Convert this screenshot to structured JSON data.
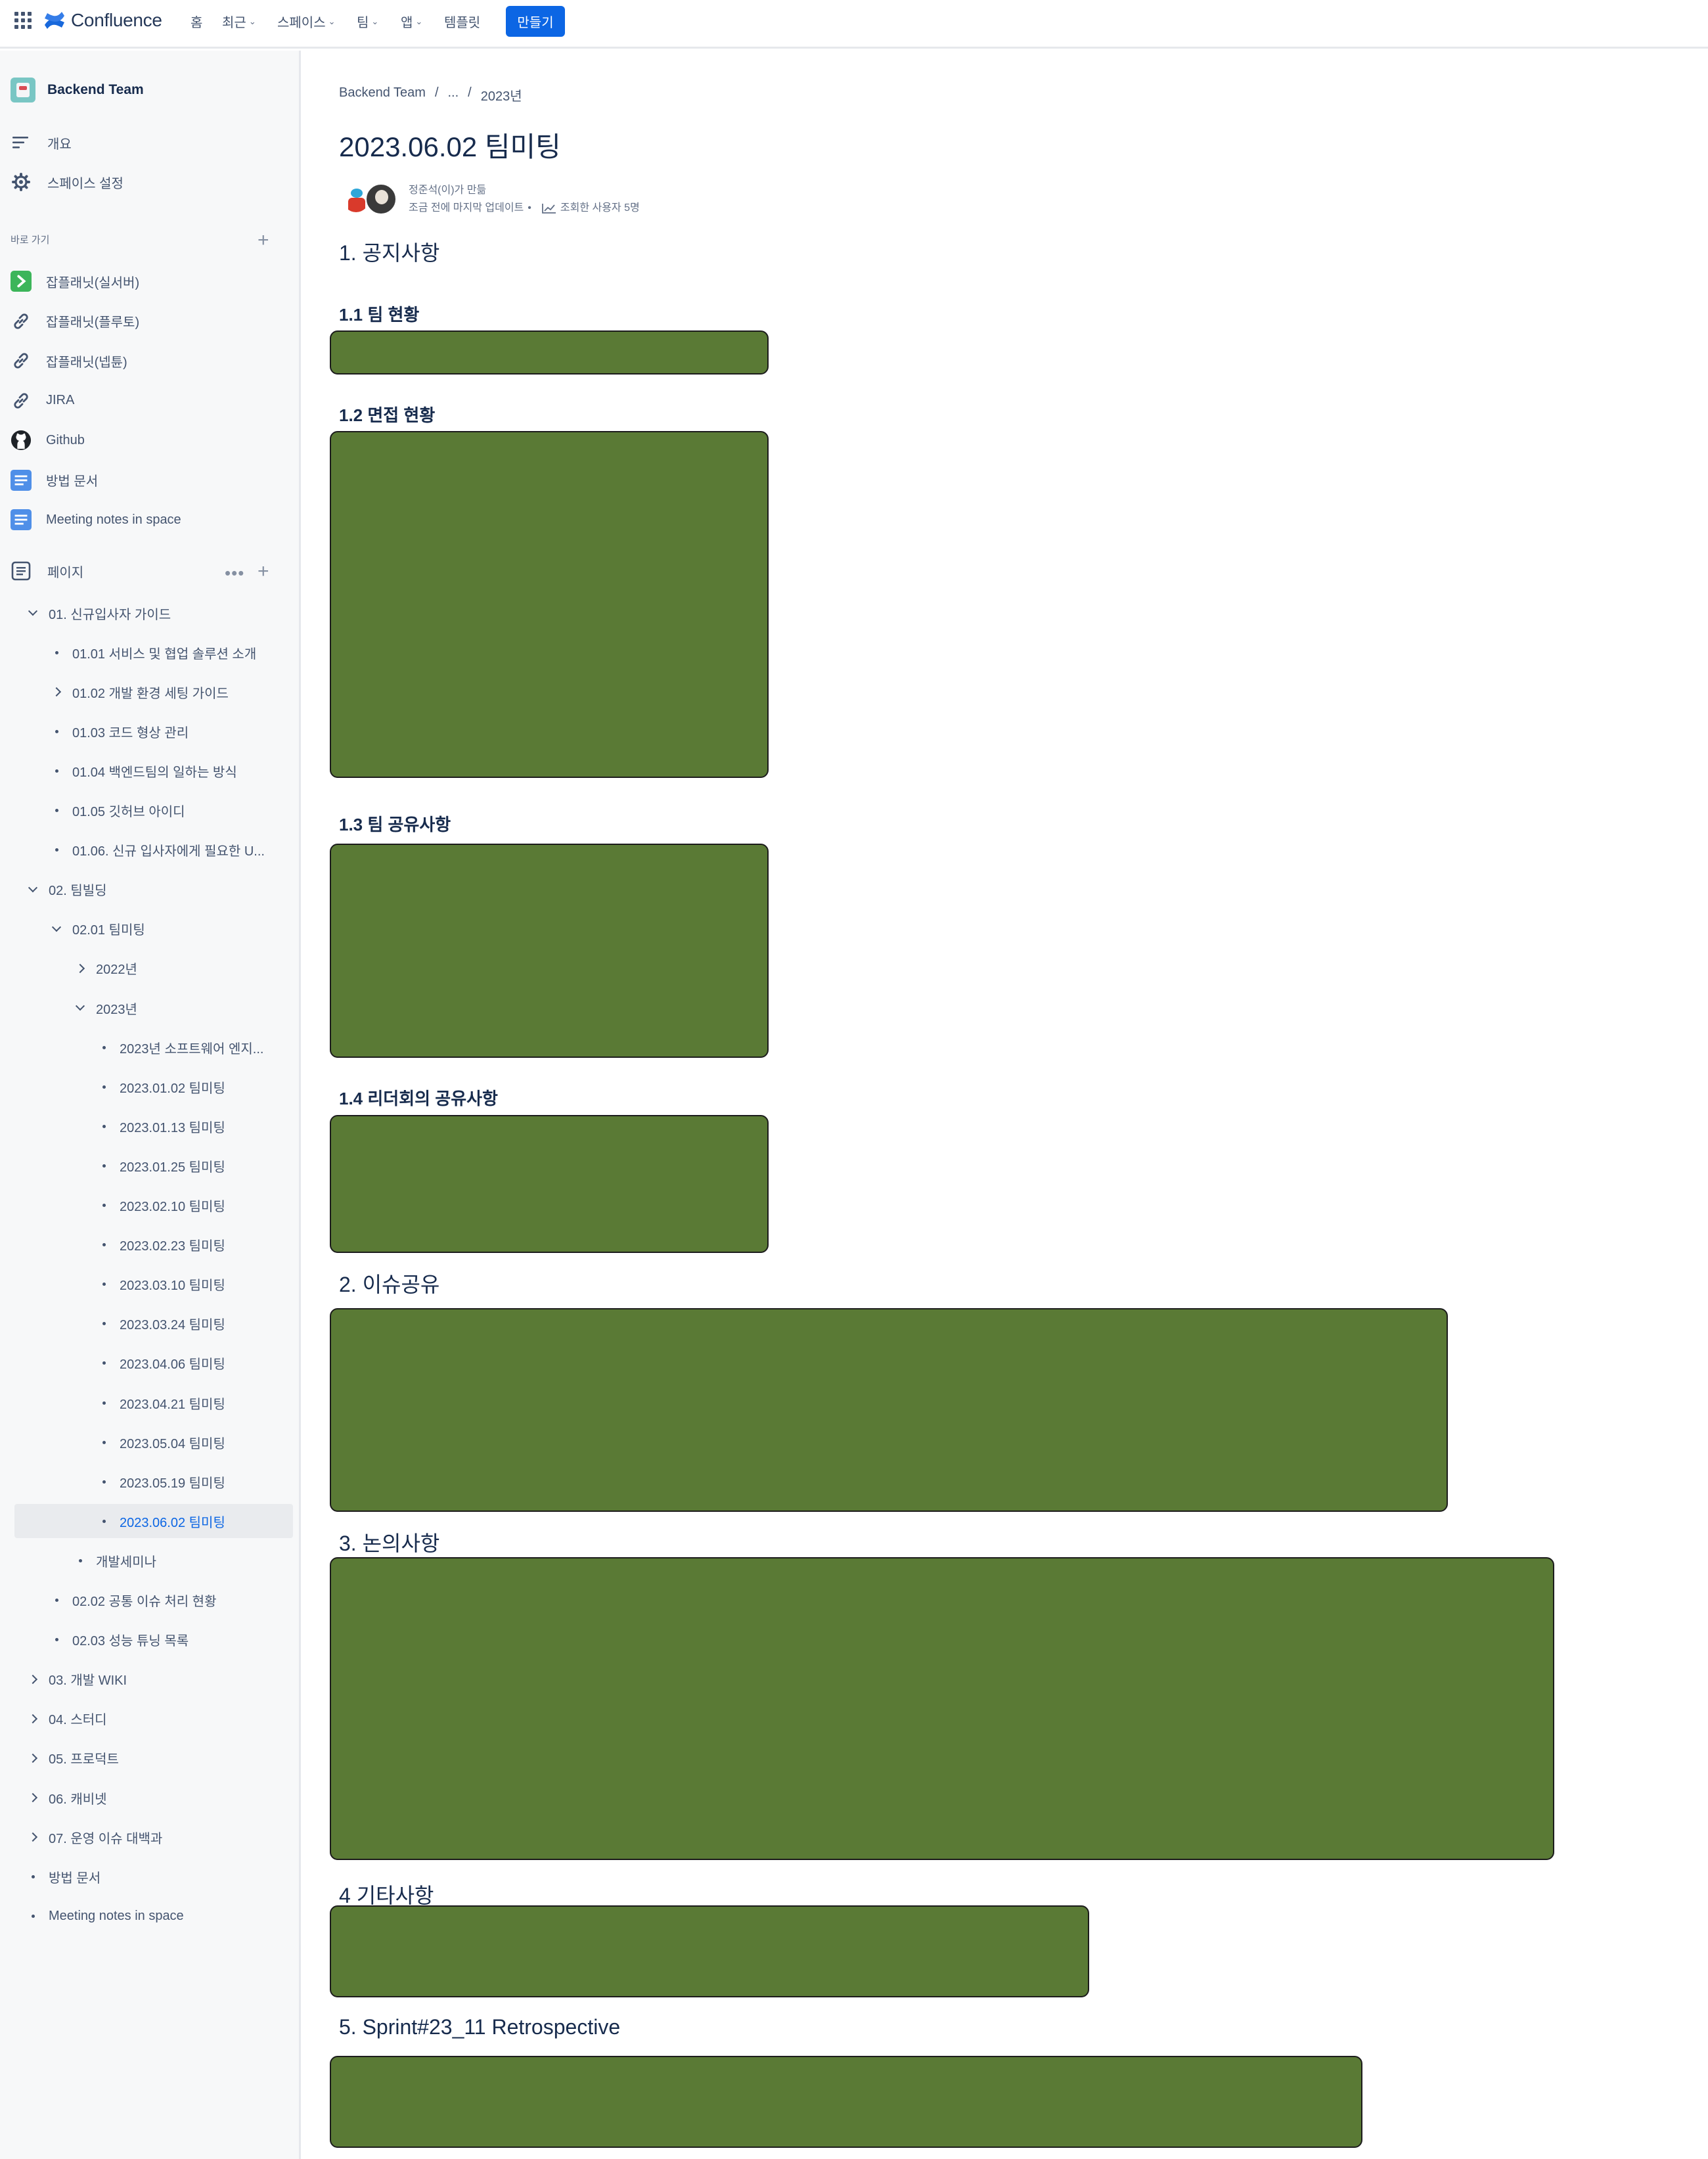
{
  "topnav": {
    "app": "Confluence",
    "items": [
      {
        "label": "홈",
        "dropdown": false
      },
      {
        "label": "최근",
        "dropdown": true
      },
      {
        "label": "스페이스",
        "dropdown": true
      },
      {
        "label": "팀",
        "dropdown": true
      },
      {
        "label": "앱",
        "dropdown": true
      },
      {
        "label": "템플릿",
        "dropdown": false
      }
    ],
    "create": "만들기",
    "accent": "#0c66e4"
  },
  "sidebar": {
    "space_name": "Backend Team",
    "overview": "개요",
    "settings": "스페이스 설정",
    "shortcuts_label": "바로 가기",
    "shortcuts": [
      {
        "label": "잡플래닛(실서버)",
        "icon": "jobplanet-icon"
      },
      {
        "label": "잡플래닛(플루토)",
        "icon": "link-icon"
      },
      {
        "label": "잡플래닛(넵튠)",
        "icon": "link-icon"
      },
      {
        "label": "JIRA",
        "icon": "link-icon"
      },
      {
        "label": "Github",
        "icon": "github-icon"
      },
      {
        "label": "방법 문서",
        "icon": "document-icon"
      },
      {
        "label": "Meeting notes in space",
        "icon": "document-icon"
      }
    ],
    "pages_label": "페이지",
    "tree": [
      {
        "label": "01. 신규입사자 가이드",
        "level": 0,
        "marker": "down"
      },
      {
        "label": "01.01 서비스 및 협업 솔루션 소개",
        "level": 1,
        "marker": "dot"
      },
      {
        "label": "01.02 개발 환경 세팅 가이드",
        "level": 1,
        "marker": "right"
      },
      {
        "label": "01.03 코드 형상 관리",
        "level": 1,
        "marker": "dot"
      },
      {
        "label": "01.04 백엔드팀의 일하는 방식",
        "level": 1,
        "marker": "dot"
      },
      {
        "label": "01.05 깃허브 아이디",
        "level": 1,
        "marker": "dot"
      },
      {
        "label": "01.06. 신규 입사자에게 필요한 U...",
        "level": 1,
        "marker": "dot"
      },
      {
        "label": "02. 팀빌딩",
        "level": 0,
        "marker": "down"
      },
      {
        "label": "02.01 팀미팅",
        "level": 1,
        "marker": "down"
      },
      {
        "label": "2022년",
        "level": 2,
        "marker": "right"
      },
      {
        "label": "2023년",
        "level": 2,
        "marker": "down"
      },
      {
        "label": "2023년 소프트웨어 엔지...",
        "level": 3,
        "marker": "dot"
      },
      {
        "label": "2023.01.02 팀미팅",
        "level": 3,
        "marker": "dot"
      },
      {
        "label": "2023.01.13 팀미팅",
        "level": 3,
        "marker": "dot"
      },
      {
        "label": "2023.01.25 팀미팅",
        "level": 3,
        "marker": "dot"
      },
      {
        "label": "2023.02.10 팀미팅",
        "level": 3,
        "marker": "dot"
      },
      {
        "label": "2023.02.23 팀미팅",
        "level": 3,
        "marker": "dot"
      },
      {
        "label": "2023.03.10 팀미팅",
        "level": 3,
        "marker": "dot"
      },
      {
        "label": "2023.03.24 팀미팅",
        "level": 3,
        "marker": "dot"
      },
      {
        "label": "2023.04.06 팀미팅",
        "level": 3,
        "marker": "dot"
      },
      {
        "label": "2023.04.21 팀미팅",
        "level": 3,
        "marker": "dot"
      },
      {
        "label": "2023.05.04 팀미팅",
        "level": 3,
        "marker": "dot"
      },
      {
        "label": "2023.05.19 팀미팅",
        "level": 3,
        "marker": "dot"
      },
      {
        "label": "2023.06.02 팀미팅",
        "level": 3,
        "marker": "dot",
        "selected": true
      },
      {
        "label": "개발세미나",
        "level": 2,
        "marker": "dot"
      },
      {
        "label": "02.02 공통 이슈 처리 현황",
        "level": 1,
        "marker": "dot"
      },
      {
        "label": "02.03 성능 튜닝 목록",
        "level": 1,
        "marker": "dot"
      },
      {
        "label": "03. 개발 WIKI",
        "level": 0,
        "marker": "right"
      },
      {
        "label": "04. 스터디",
        "level": 0,
        "marker": "right"
      },
      {
        "label": "05. 프로덕트",
        "level": 0,
        "marker": "right"
      },
      {
        "label": "06. 캐비넷",
        "level": 0,
        "marker": "right"
      },
      {
        "label": "07. 운영 이슈 대백과",
        "level": 0,
        "marker": "right"
      },
      {
        "label": "방법 문서",
        "level": 0,
        "marker": "dot"
      },
      {
        "label": "Meeting notes in space",
        "level": 0,
        "marker": "dot"
      }
    ]
  },
  "page": {
    "breadcrumb": [
      "Backend Team",
      "/",
      "...",
      "/",
      "2023년"
    ],
    "title": "2023.06.02 팀미팅",
    "byline": {
      "author": "정준석(이)가 만듦",
      "updated": "조금 전에 마지막 업데이트",
      "separator": "•",
      "viewers": "조회한 사용자 5명"
    },
    "sections": [
      {
        "id": "s1",
        "label": "1. 공지사항",
        "kind": "h2"
      },
      {
        "id": "s11",
        "label": "1.1 팀 현황",
        "kind": "h3"
      },
      {
        "id": "s12",
        "label": "1.2 면접 현황",
        "kind": "h3"
      },
      {
        "id": "s13",
        "label": "1.3 팀 공유사항",
        "kind": "h3"
      },
      {
        "id": "s14",
        "label": "1.4 리더회의 공유사항",
        "kind": "h3"
      },
      {
        "id": "s2",
        "label": "2. 이슈공유",
        "kind": "h2"
      },
      {
        "id": "s3",
        "label": "3. 논의사항",
        "kind": "h2"
      },
      {
        "id": "s4",
        "label": "4 기타사항",
        "kind": "h2"
      },
      {
        "id": "s5",
        "label": "5. Sprint#23_11 Retrospective",
        "kind": "h2"
      }
    ],
    "redaction_color": "#5a7a35"
  }
}
